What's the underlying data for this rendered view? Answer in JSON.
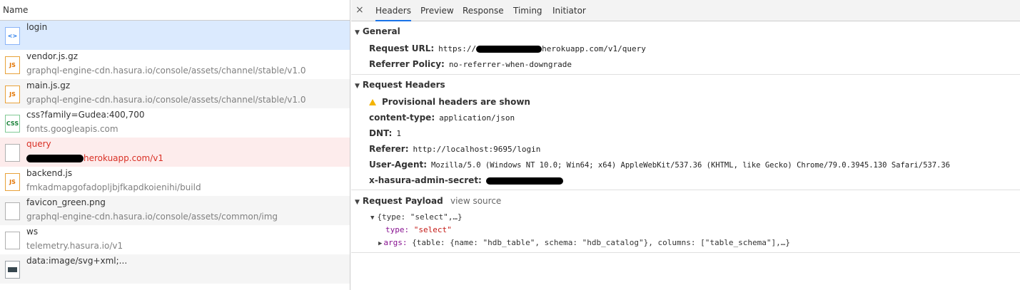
{
  "left": {
    "header": "Name",
    "rows": [
      {
        "name": "login",
        "path": "",
        "icon": "<>"
      },
      {
        "name": "vendor.js.gz",
        "path": "graphql-engine-cdn.hasura.io/console/assets/channel/stable/v1.0",
        "icon": "JS"
      },
      {
        "name": "main.js.gz",
        "path": "graphql-engine-cdn.hasura.io/console/assets/channel/stable/v1.0",
        "icon": "JS"
      },
      {
        "name": "css?family=Gudea:400,700",
        "path": "fonts.googleapis.com",
        "icon": "CSS"
      },
      {
        "name": "query",
        "path": "herokuapp.com/v1",
        "icon": ""
      },
      {
        "name": "backend.js",
        "path": "fmkadmapgofadopljbjfkapdkoienihi/build",
        "icon": "JS"
      },
      {
        "name": "favicon_green.png",
        "path": "graphql-engine-cdn.hasura.io/console/assets/common/img",
        "icon": ""
      },
      {
        "name": "ws",
        "path": "telemetry.hasura.io/v1",
        "icon": ""
      },
      {
        "name": "data:image/svg+xml;...",
        "path": "",
        "icon": ""
      }
    ]
  },
  "tabs": {
    "close": "×",
    "headers": "Headers",
    "preview": "Preview",
    "response": "Response",
    "timing": "Timing",
    "initiator": "Initiator"
  },
  "general": {
    "title": "General",
    "request_url_key": "Request URL:",
    "request_url_prefix": "https://",
    "request_url_suffix": "herokuapp.com/v1/query",
    "referrer_policy_key": "Referrer Policy:",
    "referrer_policy_value": "no-referrer-when-downgrade"
  },
  "request_headers": {
    "title": "Request Headers",
    "warning": "Provisional headers are shown",
    "content_type_key": "content-type:",
    "content_type_value": "application/json",
    "dnt_key": "DNT:",
    "dnt_value": "1",
    "referer_key": "Referer:",
    "referer_value": "http://localhost:9695/login",
    "user_agent_key": "User-Agent:",
    "user_agent_value": "Mozilla/5.0 (Windows NT 10.0; Win64; x64) AppleWebKit/537.36 (KHTML, like Gecko) Chrome/79.0.3945.130 Safari/537.36",
    "admin_secret_key": "x-hasura-admin-secret:"
  },
  "payload": {
    "title": "Request Payload",
    "view_source": "view source",
    "root": "{type: \"select\",…}",
    "type_key": "type:",
    "type_value": "\"select\"",
    "args_key": "args:",
    "args_value": "{table: {name: \"hdb_table\", schema: \"hdb_catalog\"}, columns: [\"table_schema\"],…}"
  }
}
